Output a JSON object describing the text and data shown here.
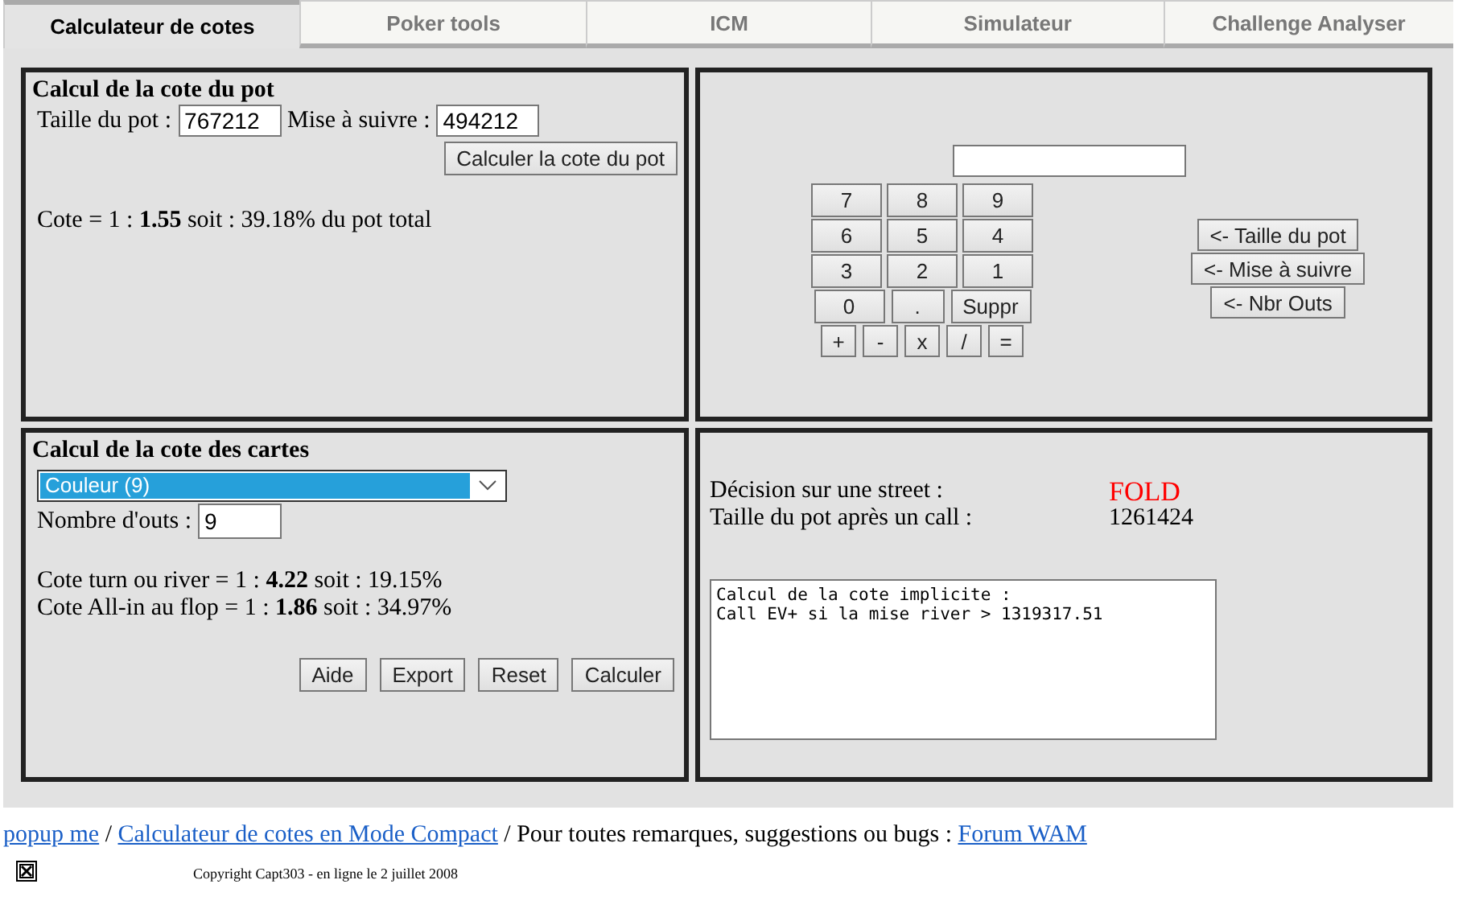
{
  "tabs": [
    {
      "label": "Calculateur de cotes",
      "selected": true
    },
    {
      "label": "Poker tools",
      "selected": false
    },
    {
      "label": "ICM",
      "selected": false
    },
    {
      "label": "Simulateur",
      "selected": false
    },
    {
      "label": "Challenge Analyser",
      "selected": false
    }
  ],
  "pot_panel": {
    "title": "Calcul de la cote du pot",
    "fields": [
      {
        "label": "Taille du pot :",
        "value": "767212"
      },
      {
        "label": "Mise à suivre :",
        "value": "494212"
      }
    ],
    "button": "Calculer la cote du pot",
    "result": "Cote = 1 : **1.55** soit : 39.18% du pot total"
  },
  "keypad_panel": {
    "rows": [
      [
        {
          "label": "7",
          "kind": "digit"
        },
        {
          "label": "8",
          "kind": "digit"
        },
        {
          "label": "9",
          "kind": "digit"
        }
      ],
      [
        {
          "label": "6",
          "kind": "digit"
        },
        {
          "label": "5",
          "kind": "digit"
        },
        {
          "label": "4",
          "kind": "digit"
        }
      ],
      [
        {
          "label": "3",
          "kind": "digit"
        },
        {
          "label": "2",
          "kind": "digit"
        },
        {
          "label": "1",
          "kind": "digit"
        }
      ],
      [
        {
          "label": "0",
          "kind": "digit"
        },
        {
          "label": ".",
          "kind": "dot"
        },
        {
          "label": "Suppr",
          "kind": "action"
        }
      ]
    ],
    "operator_keys": [
      {
        "label": "+",
        "kind": "op"
      },
      {
        "label": "-",
        "kind": "op"
      },
      {
        "label": "x",
        "kind": "op"
      },
      {
        "label": "/",
        "kind": "op"
      },
      {
        "label": "=",
        "kind": "op"
      }
    ],
    "send_buttons": [
      "<- Taille du pot",
      "<- Mise à suivre",
      "<- Nbr Outs"
    ]
  },
  "cards_panel": {
    "title": "Calcul de la cote des cartes",
    "select": {
      "value": "Couleur (9)",
      "highlighted": true
    },
    "outs": {
      "label": "Nombre d'outs :",
      "value": "9"
    },
    "results": [
      "Cote turn ou river = 1 : **4.22** soit : 19.15%",
      "Cote All-in au flop = 1 : **1.86** soit : 34.97%"
    ],
    "buttons": [
      "Aide",
      "Export",
      "Reset",
      "Calculer"
    ]
  },
  "decision_panel": {
    "rows": [
      {
        "label": "Décision sur une street :",
        "value": "FOLD",
        "color": "#ff0000"
      },
      {
        "label": "Taille du pot après un call :",
        "value": "1261424",
        "color": "#000000"
      }
    ],
    "implied_odds": "Calcul de la cote implicite :\nCall EV+ si la mise river > 1319317.51"
  },
  "footer": {
    "parts": [
      {
        "kind": "link",
        "text": "popup me"
      },
      {
        "kind": "text",
        "text": " / "
      },
      {
        "kind": "link",
        "text": "Calculateur de cotes en Mode Compact"
      },
      {
        "kind": "text",
        "text": " / Pour toutes remarques, suggestions ou bugs : "
      },
      {
        "kind": "link",
        "text": "Forum WAM"
      }
    ],
    "copyright": "Copyright Capt303 - en ligne le 2 juillet 2008"
  }
}
